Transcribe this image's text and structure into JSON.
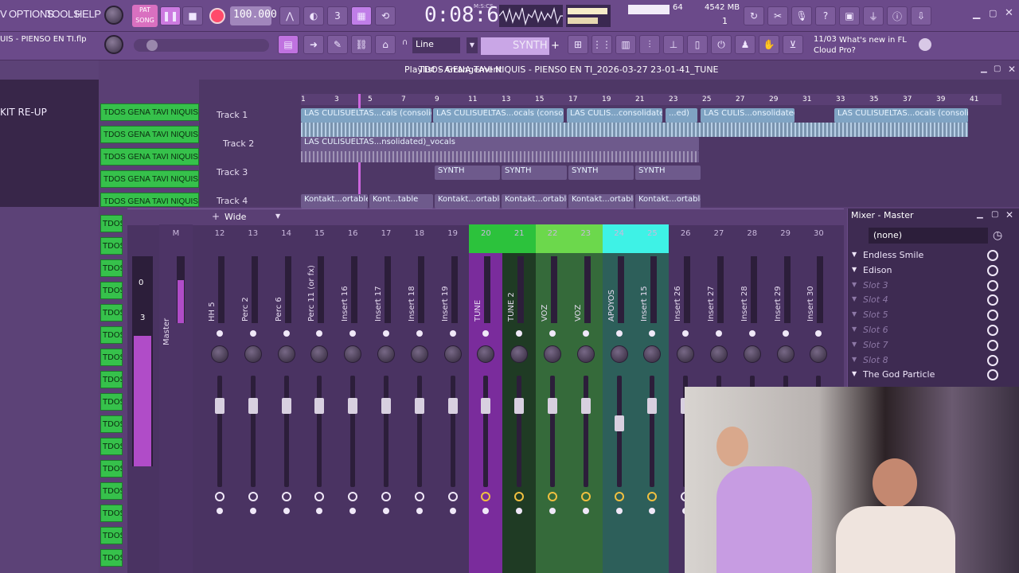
{
  "menu": [
    "V",
    "OPTIONS",
    "TOOLS",
    "HELP"
  ],
  "song_mode": "SONG",
  "pat_label": "PAT",
  "tempo": "100.000",
  "time_display": "0:08:65",
  "time_unit": "M:S:CS",
  "cpu_value": "64",
  "ram_value": "4542 MB",
  "ram_sub": "1",
  "project_file": "UIS - PIENSO EN TI.flp",
  "snap_mode": "Line",
  "instrument": "SYNTH",
  "news_date": "11/03",
  "news_text": "What's new in FL Cloud Pro?",
  "browser_item": "KIT RE-UP",
  "playlist_title": "Playlist - Arrangement",
  "playlist_song": "TDOS GENA TAVI NIQUIS - PIENSO EN TI_2026-03-27 23-01-41_TUNE",
  "ruler": [
    "1",
    "3",
    "5",
    "7",
    "9",
    "11",
    "13",
    "15",
    "17",
    "19",
    "21",
    "23",
    "25",
    "27",
    "29",
    "31",
    "33",
    "35",
    "37",
    "39",
    "41"
  ],
  "tracks": [
    "Track 1",
    "Track 2",
    "Track 3",
    "Track 4"
  ],
  "clips_t1": [
    "LAS CULISUELTAS...cals (consolidated)",
    "LAS CULISUELTAS...ocals (consolidated)",
    "LAS CULIS...consolidated)",
    "...ed)",
    "LAS CULIS...onsolidated)",
    "LAS CULISUELTAS...ocals (consolidated)"
  ],
  "clip_t2": "LAS CULISUELTAS...nsolidated)_vocals",
  "clips_t3": [
    "SYNTH",
    "SYNTH",
    "SYNTH",
    "SYNTH"
  ],
  "clips_t4": [
    "Kontakt...ortable",
    "Kont...table",
    "Kontakt...ortable",
    "Kontakt...ortable",
    "Kontakt...ortable",
    "Kontakt...ortable"
  ],
  "channels": [
    "TDOS GENA TAVI NIQUIS -...",
    "TDOS GENA TAVI NIQUIS -...",
    "TDOS GENA TAVI NIQUIS -...",
    "TDOS GENA TAVI NIQUIS -...",
    "TDOS GENA TAVI NIQUIS -..."
  ],
  "channels_short": [
    "TDOS",
    "TDOS",
    "TDOS",
    "TDOS",
    "TDOS",
    "TDOS",
    "TDOS",
    "TDOS",
    "TDOS",
    "TDOS",
    "TDOS",
    "TDOS",
    "TDOS",
    "TDOS",
    "TDOS",
    "TDOS"
  ],
  "mixer_view": "Wide",
  "master_strip": {
    "num": "M",
    "name": "Master",
    "db_top": "0",
    "db_mid": "3"
  },
  "strips": [
    {
      "num": "12",
      "name": "HH 5",
      "color": ""
    },
    {
      "num": "13",
      "name": "Perc 2",
      "color": ""
    },
    {
      "num": "14",
      "name": "Perc 6",
      "color": ""
    },
    {
      "num": "15",
      "name": "Perc 11 (or fx)",
      "color": ""
    },
    {
      "num": "16",
      "name": "Insert 16",
      "color": ""
    },
    {
      "num": "17",
      "name": "Insert 17",
      "color": ""
    },
    {
      "num": "18",
      "name": "Insert 18",
      "color": ""
    },
    {
      "num": "19",
      "name": "Insert 19",
      "color": ""
    },
    {
      "num": "20",
      "name": "TUNE",
      "color": "#7a2c9c"
    },
    {
      "num": "21",
      "name": "TUNE 2",
      "color": "#1f3b24"
    },
    {
      "num": "22",
      "name": "VOZ",
      "color": "#356a3a"
    },
    {
      "num": "23",
      "name": "VOZ",
      "color": "#356a3a"
    },
    {
      "num": "24",
      "name": "APOYOS",
      "color": "#2d5f5a"
    },
    {
      "num": "25",
      "name": "Insert 15",
      "color": "#2d5f5a"
    },
    {
      "num": "26",
      "name": "Insert 26",
      "color": ""
    },
    {
      "num": "27",
      "name": "Insert 27",
      "color": ""
    },
    {
      "num": "28",
      "name": "Insert 28",
      "color": ""
    },
    {
      "num": "29",
      "name": "Insert 29",
      "color": ""
    },
    {
      "num": "30",
      "name": "Insert 30",
      "color": ""
    }
  ],
  "fx_panel": {
    "title": "Mixer - Master",
    "preset": "(none)",
    "slots": [
      {
        "label": "Endless Smile",
        "active": true
      },
      {
        "label": "Edison",
        "active": true
      },
      {
        "label": "Slot 3",
        "active": false
      },
      {
        "label": "Slot 4",
        "active": false
      },
      {
        "label": "Slot 5",
        "active": false
      },
      {
        "label": "Slot 6",
        "active": false
      },
      {
        "label": "Slot 7",
        "active": false
      },
      {
        "label": "Slot 8",
        "active": false
      },
      {
        "label": "The God Particle",
        "active": true
      }
    ]
  },
  "colors": {
    "accent": "#b8f24c",
    "green_header": "#2cc23c",
    "cyan_header": "#3ef2e6"
  }
}
